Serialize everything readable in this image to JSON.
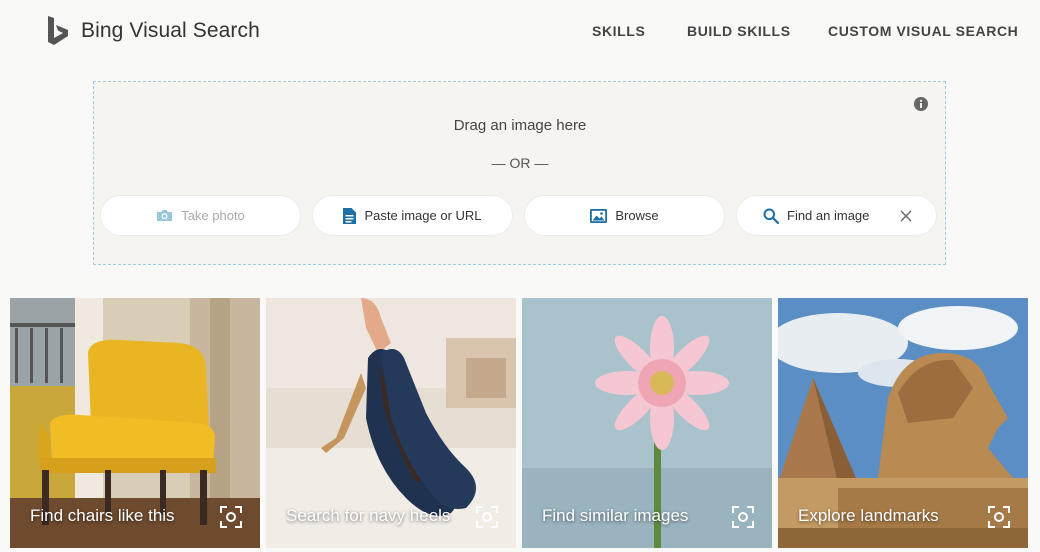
{
  "header": {
    "brand": "Bing Visual Search",
    "nav": [
      {
        "label": "SKILLS"
      },
      {
        "label": "BUILD SKILLS"
      },
      {
        "label": "CUSTOM VISUAL SEARCH"
      }
    ]
  },
  "dropzone": {
    "drag_text": "Drag an image here",
    "or_text": "— OR —",
    "buttons": {
      "take_photo": "Take photo",
      "paste": "Paste image or URL",
      "browse": "Browse"
    },
    "search_placeholder": "Find an image"
  },
  "cards": [
    {
      "label": "Find chairs like this"
    },
    {
      "label": "Search for navy heels"
    },
    {
      "label": "Find similar images"
    },
    {
      "label": "Explore landmarks"
    }
  ],
  "icons": {
    "logo": "bing-logo-icon",
    "info": "info-icon",
    "camera": "camera-icon",
    "document": "document-icon",
    "image": "image-icon",
    "search": "search-icon",
    "clear": "close-icon",
    "lens": "visual-search-icon"
  },
  "colors": {
    "accent": "#1d6fa5",
    "dropzone_border": "#9fcde3"
  }
}
